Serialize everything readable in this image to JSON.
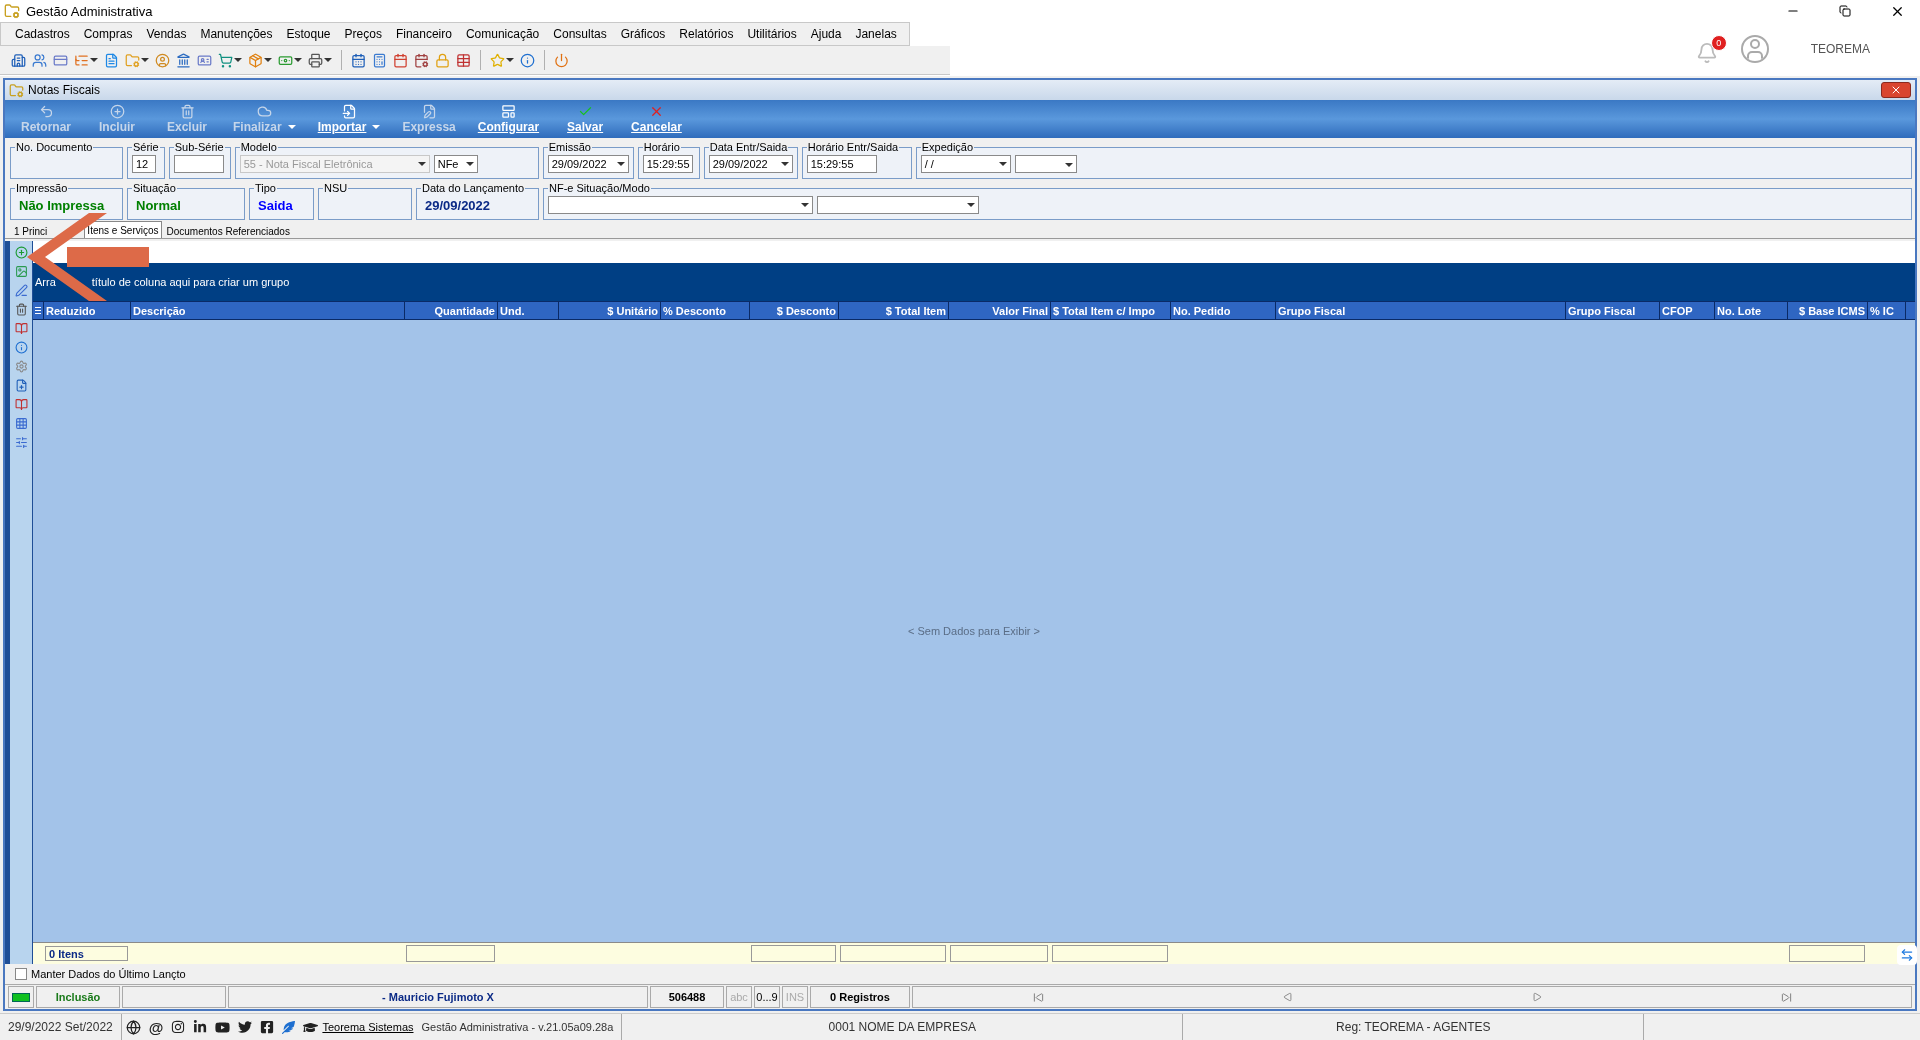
{
  "window": {
    "title": "Gestão Administrativa"
  },
  "menu": [
    "Cadastros",
    "Compras",
    "Vendas",
    "Manutenções",
    "Estoque",
    "Preços",
    "Financeiro",
    "Comunicação",
    "Consultas",
    "Gráficos",
    "Relatórios",
    "Utilitários",
    "Ajuda",
    "Janelas"
  ],
  "notifications": {
    "count": "0"
  },
  "user": {
    "name": "TEOREMA"
  },
  "child_window": {
    "title": "Notas Fiscais"
  },
  "ribbon": [
    {
      "label": "Retornar",
      "disabled": true,
      "dropdown": false
    },
    {
      "label": "Incluir",
      "disabled": true,
      "dropdown": false
    },
    {
      "label": "Excluir",
      "disabled": true,
      "dropdown": false
    },
    {
      "label": "Finalizar",
      "disabled": true,
      "dropdown": true
    },
    {
      "label": "Importar",
      "disabled": false,
      "dropdown": true
    },
    {
      "label": "Expressa",
      "disabled": true,
      "dropdown": false
    },
    {
      "label": "Configurar",
      "disabled": false,
      "dropdown": false
    },
    {
      "label": "Salvar",
      "disabled": false,
      "dropdown": false
    },
    {
      "label": "Cancelar",
      "disabled": false,
      "dropdown": false
    }
  ],
  "fields_row_1": [
    {
      "label": "No. Documento",
      "kind": "empty"
    },
    {
      "label": "Série",
      "kind": "input",
      "value": "12"
    },
    {
      "label": "Sub-Série",
      "kind": "input"
    },
    {
      "label": "Modelo",
      "kind": "model",
      "value": "55 - Nota Fiscal Eletrônica",
      "disabled": true,
      "second_value": "NFe"
    },
    {
      "label": "Emissão",
      "kind": "select",
      "value": "29/09/2022"
    },
    {
      "label": "Horário",
      "kind": "input",
      "value": "15:29:55"
    },
    {
      "label": "Data Entr/Saida",
      "kind": "select",
      "value": "29/09/2022"
    },
    {
      "label": "Horário Entr/Saida",
      "kind": "input",
      "value": "15:29:55"
    },
    {
      "label": "Expedição",
      "kind": "date_spin",
      "value": " /  /"
    }
  ],
  "fields_row_2": [
    {
      "label": "Impressão",
      "kind": "status",
      "value": "Não Impressa",
      "color": "#008000"
    },
    {
      "label": "Situação",
      "kind": "status",
      "value": "Normal",
      "color": "#008000"
    },
    {
      "label": "Tipo",
      "kind": "status",
      "value": "Saida",
      "color": "#0000ff"
    },
    {
      "label": "NSU",
      "kind": "empty"
    },
    {
      "label": "Data do Lançamento",
      "kind": "status",
      "value": "29/09/2022",
      "color": "#0b2a86"
    },
    {
      "label": "NF-e Situação/Modo",
      "kind": "two_selects"
    }
  ],
  "tabs": [
    {
      "label": "1 Princi",
      "selected": false
    },
    {
      "label": "Itens e Serviços",
      "selected": true
    },
    {
      "label": "Documentos Referenciados",
      "selected": false
    }
  ],
  "grid": {
    "group_hint_start": "Arra",
    "group_hint_end": "título de coluna aqui para criar um grupo",
    "columns": [
      {
        "title": "Reduzido",
        "kind": "text",
        "summary": true
      },
      {
        "title": "Descrição",
        "kind": "text",
        "summary": false
      },
      {
        "title": "Quantidade",
        "kind": "number",
        "summary": true
      },
      {
        "title": "Und.",
        "kind": "text",
        "summary": false
      },
      {
        "title": "$ Unitário",
        "kind": "number",
        "summary": false
      },
      {
        "title": "% Desconto",
        "kind": "text",
        "summary": false
      },
      {
        "title": "$ Desconto",
        "kind": "number",
        "summary": true
      },
      {
        "title": "$ Total Item",
        "kind": "number",
        "summary": true
      },
      {
        "title": "Valor Final",
        "kind": "number",
        "summary": true
      },
      {
        "title": "$ Total Item c/ Impo",
        "kind": "text",
        "summary": true
      },
      {
        "title": "No. Pedido",
        "kind": "text",
        "summary": false
      },
      {
        "title": "Grupo Fiscal",
        "kind": "text",
        "summary": false
      },
      {
        "title": "Grupo Fiscal",
        "kind": "text",
        "summary": false
      },
      {
        "title": "CFOP",
        "kind": "text",
        "summary": false
      },
      {
        "title": "No. Lote",
        "kind": "text",
        "summary": false
      },
      {
        "title": "$ Base ICMS",
        "kind": "number",
        "summary": true
      },
      {
        "title": "% IC",
        "kind": "text",
        "summary": false
      }
    ],
    "empty_text": "< Sem Dados para Exibir >",
    "footer_count": "0 Itens"
  },
  "keep_data": {
    "label": "Manter Dados do Último Lançto",
    "checked": false
  },
  "status_bar": {
    "mode": "Inclusão",
    "user": "- Mauricio Fujimoto X",
    "code": "506488",
    "abc": "abc",
    "digits": "0...9",
    "ins": "INS",
    "records": "0 Registros"
  },
  "bottom_bar": {
    "date": "29/9/2022 Set/2022",
    "at": "@",
    "link": "Teorema Sistemas",
    "version": "Gestão Administrativa - v.21.05a09.28a",
    "company": "0001 NOME DA EMPRESA",
    "registration": "Reg: TEOREMA - AGENTES"
  }
}
